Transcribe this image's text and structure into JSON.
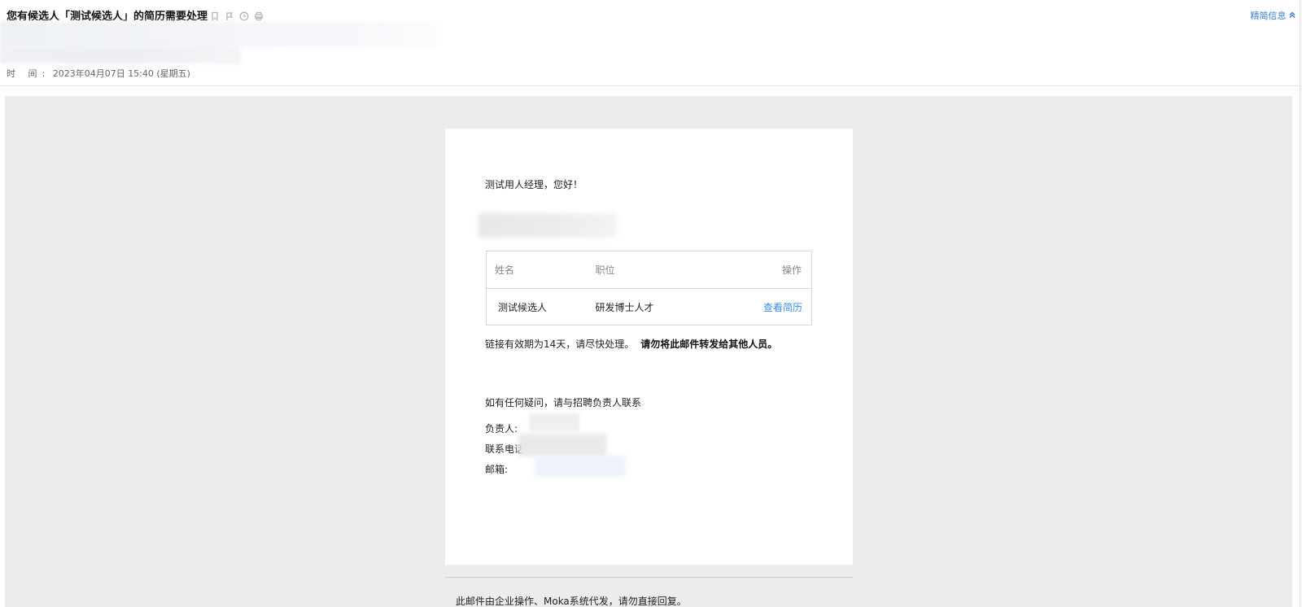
{
  "header": {
    "subject": "您有候选人「测试候选人」的简历需要处理",
    "brief_label": "精简信息",
    "time_label": "时 间:",
    "time_value": "2023年04月07日 15:40 (星期五)",
    "icons": [
      "bookmark-icon",
      "flag-icon",
      "clock-icon",
      "print-icon",
      "chevron-up-icon"
    ]
  },
  "body": {
    "greeting": "测试用人经理，您好！",
    "table": {
      "headers": [
        "姓名",
        "职位",
        "操作"
      ],
      "rows": [
        {
          "name": "测试候选人",
          "position": "研发博士人才",
          "action": "查看简历"
        }
      ]
    },
    "validity_text": "链接有效期为14天，请尽快处理。",
    "validity_bold": "请勿将此邮件转发给其他人员。",
    "contact_intro": "如有任何疑问，请与招聘负责人联系",
    "contact": {
      "owner_label": "负责人:",
      "phone_label": "联系电话",
      "email_label": "邮箱:"
    }
  },
  "footer": {
    "text": "此邮件由企业操作、Moka系统代发，请勿直接回复。"
  },
  "colors": {
    "link": "#3a8ee6",
    "header_link": "#3a7bd5",
    "background": "#ececec"
  }
}
